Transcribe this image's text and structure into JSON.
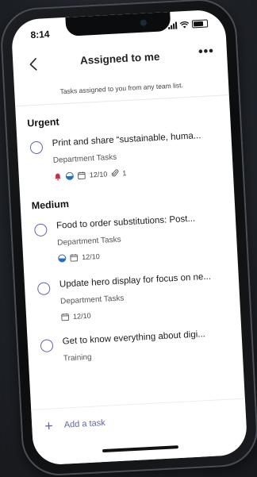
{
  "status_bar": {
    "time": "8:14"
  },
  "header": {
    "title": "Assigned to me"
  },
  "subtitle": "Tasks assigned to you from any team list.",
  "sections": [
    {
      "heading": "Urgent",
      "tasks": [
        {
          "title": "Print and share “sustainable, huma...",
          "list": "Department Tasks",
          "date": "12/10",
          "attachments": "1"
        }
      ]
    },
    {
      "heading": "Medium",
      "tasks": [
        {
          "title": "Food to order substitutions: Post...",
          "list": "Department Tasks",
          "date": "12/10"
        },
        {
          "title": "Update hero display for focus on ne...",
          "list": "Department Tasks",
          "date": "12/10"
        },
        {
          "title": "Get to know everything about digi...",
          "list": "Training"
        }
      ]
    }
  ],
  "footer": {
    "add_task_label": "Add a task"
  },
  "icons": {
    "back": "chevron-left-icon",
    "more": "more-icon",
    "task_status": "empty-circle-icon",
    "urgent": "bell-icon",
    "progress": "half-circle-progress-icon",
    "due_date": "calendar-icon",
    "attachment": "paperclip-icon",
    "add": "plus-icon"
  },
  "colors": {
    "accent": "#6264a7",
    "urgent": "#c4314b",
    "progress": "#2a6ebb"
  }
}
